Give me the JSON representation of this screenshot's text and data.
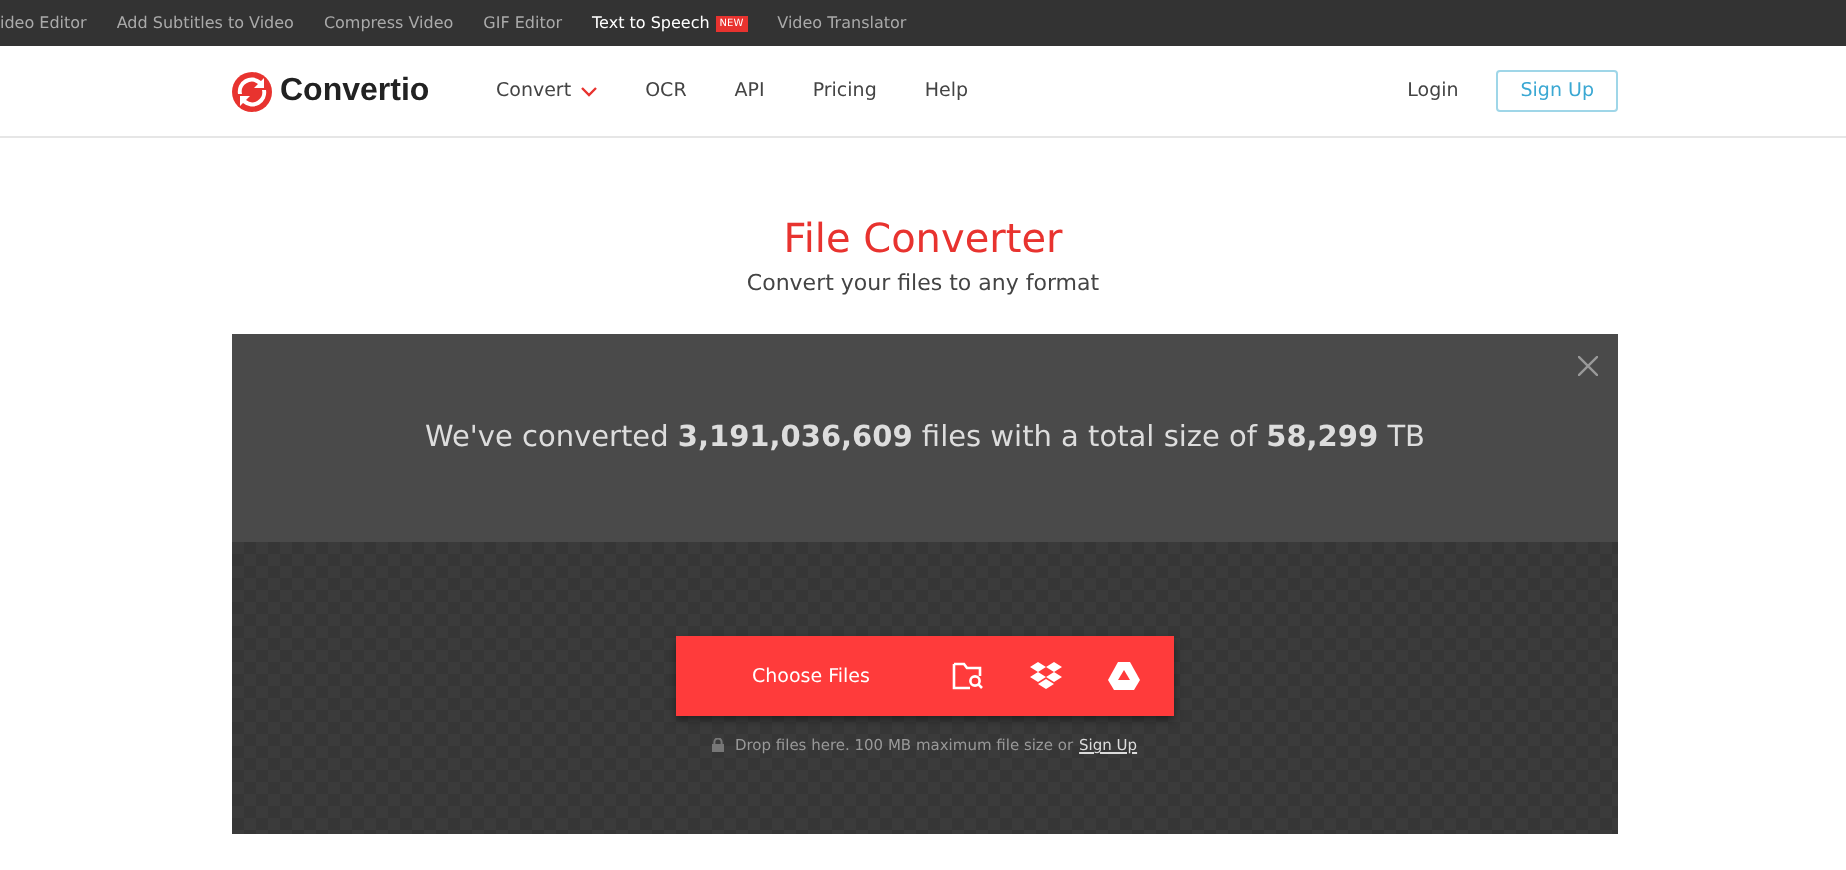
{
  "top_bar": {
    "links": [
      {
        "label": "ideo Editor",
        "selected": false
      },
      {
        "label": "Add Subtitles to Video",
        "selected": false
      },
      {
        "label": "Compress Video",
        "selected": false
      },
      {
        "label": "GIF Editor",
        "selected": false
      },
      {
        "label": "Text to Speech",
        "badge": "NEW",
        "selected": true
      },
      {
        "label": "Video Translator",
        "selected": false
      }
    ]
  },
  "header": {
    "logo": "Convertio",
    "nav": [
      {
        "label": "Convert",
        "dropdown": true
      },
      {
        "label": "OCR",
        "dropdown": false
      },
      {
        "label": "API",
        "dropdown": false
      },
      {
        "label": "Pricing",
        "dropdown": false
      },
      {
        "label": "Help",
        "dropdown": false
      }
    ],
    "login": "Login",
    "signup": "Sign Up"
  },
  "hero": {
    "title": "File Converter",
    "subtitle": "Convert your files to any format"
  },
  "panel": {
    "stats": "We've converted **3,191,036,609** files with a total size of **58,299** TB",
    "choose_button": "Choose Files",
    "drop_text": "Drop files here. 100 MB maximum file size or",
    "drop_link": "Sign Up"
  }
}
